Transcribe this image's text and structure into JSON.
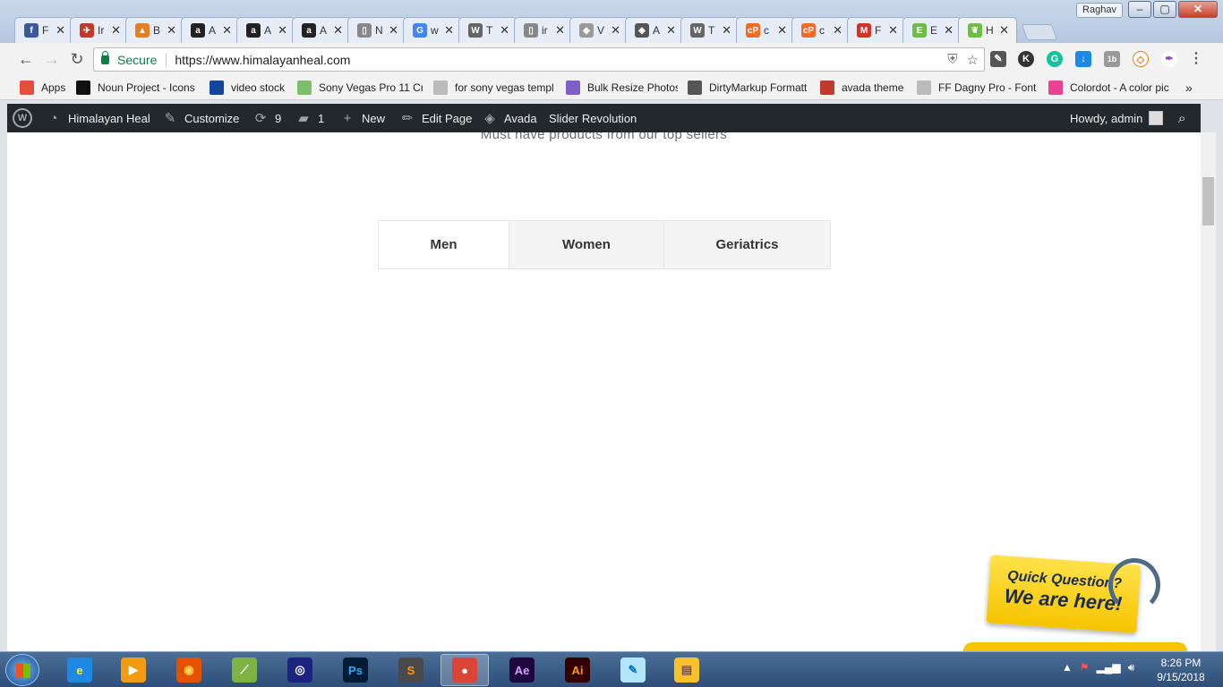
{
  "browser": {
    "user": "Raghav",
    "window_buttons": [
      "–",
      "▢",
      "✕"
    ],
    "tabs": [
      {
        "icon": "facebook-icon",
        "letter": "f",
        "title": "F",
        "color": "#3b5998"
      },
      {
        "icon": "site-icon",
        "letter": "✈",
        "title": "Ir",
        "color": "#c0392b"
      },
      {
        "icon": "site-icon",
        "letter": "▲",
        "title": "B",
        "color": "#e67e22"
      },
      {
        "icon": "amazon-icon",
        "letter": "a",
        "title": "A",
        "color": "#222222"
      },
      {
        "icon": "amazon-icon",
        "letter": "a",
        "title": "A",
        "color": "#222222"
      },
      {
        "icon": "amazon-icon",
        "letter": "a",
        "title": "A",
        "color": "#222222"
      },
      {
        "icon": "page-icon",
        "letter": "▯",
        "title": "N",
        "color": "#888888"
      },
      {
        "icon": "google-icon",
        "letter": "G",
        "title": "w",
        "color": "#4285f4"
      },
      {
        "icon": "wordpress-icon",
        "letter": "W",
        "title": "T",
        "color": "#666666"
      },
      {
        "icon": "page-icon",
        "letter": "▯",
        "title": "ir",
        "color": "#888888"
      },
      {
        "icon": "layers-icon",
        "letter": "◆",
        "title": "V",
        "color": "#999999"
      },
      {
        "icon": "avada-icon",
        "letter": "◈",
        "title": "A",
        "color": "#555555"
      },
      {
        "icon": "wordpress-icon",
        "letter": "W",
        "title": "T",
        "color": "#666666"
      },
      {
        "icon": "cpanel-icon",
        "letter": "cP",
        "title": "c",
        "color": "#f26b21"
      },
      {
        "icon": "cpanel-icon",
        "letter": "cP",
        "title": "c",
        "color": "#f26b21"
      },
      {
        "icon": "gmail-icon",
        "letter": "M",
        "title": "F",
        "color": "#d93025"
      },
      {
        "icon": "evernote-icon",
        "letter": "E",
        "title": "E",
        "color": "#6dbe45"
      },
      {
        "icon": "leaf-icon",
        "letter": "❦",
        "title": "H",
        "color": "#6dbe45"
      }
    ],
    "address": {
      "secure_label": "Secure",
      "url": "https://www.himalayanheal.com"
    },
    "bookmarks": [
      {
        "label": "Apps",
        "icon": "apps-icon",
        "color": "#e74c3c"
      },
      {
        "label": "Noun Project - Icons",
        "icon": "noun-project-icon",
        "color": "#111111"
      },
      {
        "label": "video stock",
        "icon": "v-icon",
        "color": "#1446a0"
      },
      {
        "label": "Sony Vegas Pro 11 Cr",
        "icon": "sony-icon",
        "color": "#7bbf6a"
      },
      {
        "label": "for sony vegas templ",
        "icon": "page-icon",
        "color": "#bbbbbb"
      },
      {
        "label": "Bulk Resize Photos",
        "icon": "resize-icon",
        "color": "#7d5fc7"
      },
      {
        "label": "DirtyMarkup Formatt",
        "icon": "code-icon",
        "color": "#555555"
      },
      {
        "label": "avada theme",
        "icon": "themefusion-icon",
        "color": "#c0392b"
      },
      {
        "label": "FF Dagny Pro - Font r",
        "icon": "page-icon",
        "color": "#bbbbbb"
      },
      {
        "label": "Colordot - A color pic",
        "icon": "colordot-icon",
        "color": "#e84393"
      }
    ]
  },
  "adminbar": {
    "site_name": "Himalayan Heal",
    "customize": "Customize",
    "updates_count": "9",
    "comments_count": "1",
    "new": "New",
    "edit_page": "Edit Page",
    "avada": "Avada",
    "slider_revolution": "Slider Revolution",
    "howdy": "Howdy, admin"
  },
  "page": {
    "subtitle": "Must have products from our top sellers",
    "tabs": [
      "Men",
      "Women",
      "Geriatrics"
    ]
  },
  "widget": {
    "line1": "Quick Question?",
    "line2": "We are here!"
  },
  "taskbar": {
    "apps": [
      {
        "name": "internet-explorer-icon",
        "label": "e",
        "bg": "#1e88e5",
        "fg": "#ffeb3b"
      },
      {
        "name": "media-player-icon",
        "label": "▶",
        "bg": "#f39c12",
        "fg": "#ffffff"
      },
      {
        "name": "firefox-icon",
        "label": "◉",
        "bg": "#e65100",
        "fg": "#ffd54f"
      },
      {
        "name": "green-app-icon",
        "label": "⟋",
        "bg": "#7cb342",
        "fg": "#ffffff"
      },
      {
        "name": "browser-globe-icon",
        "label": "◎",
        "bg": "#1a237e",
        "fg": "#ffffff"
      },
      {
        "name": "photoshop-icon",
        "label": "Ps",
        "bg": "#001d34",
        "fg": "#31a8ff"
      },
      {
        "name": "sublime-icon",
        "label": "S",
        "bg": "#4a4a4a",
        "fg": "#ff9800"
      },
      {
        "name": "chrome-icon",
        "label": "●",
        "bg": "#db4437",
        "fg": "#ffffff"
      },
      {
        "name": "after-effects-icon",
        "label": "Ae",
        "bg": "#1f0740",
        "fg": "#d8a1ff"
      },
      {
        "name": "illustrator-icon",
        "label": "Ai",
        "bg": "#330000",
        "fg": "#ff9a00"
      },
      {
        "name": "notepad-icon",
        "label": "✎",
        "bg": "#b3e5fc",
        "fg": "#0277bd"
      },
      {
        "name": "explorer-folder-icon",
        "label": "▤",
        "bg": "#fbc02d",
        "fg": "#795548"
      }
    ],
    "time": "8:26 PM",
    "date": "9/15/2018"
  }
}
